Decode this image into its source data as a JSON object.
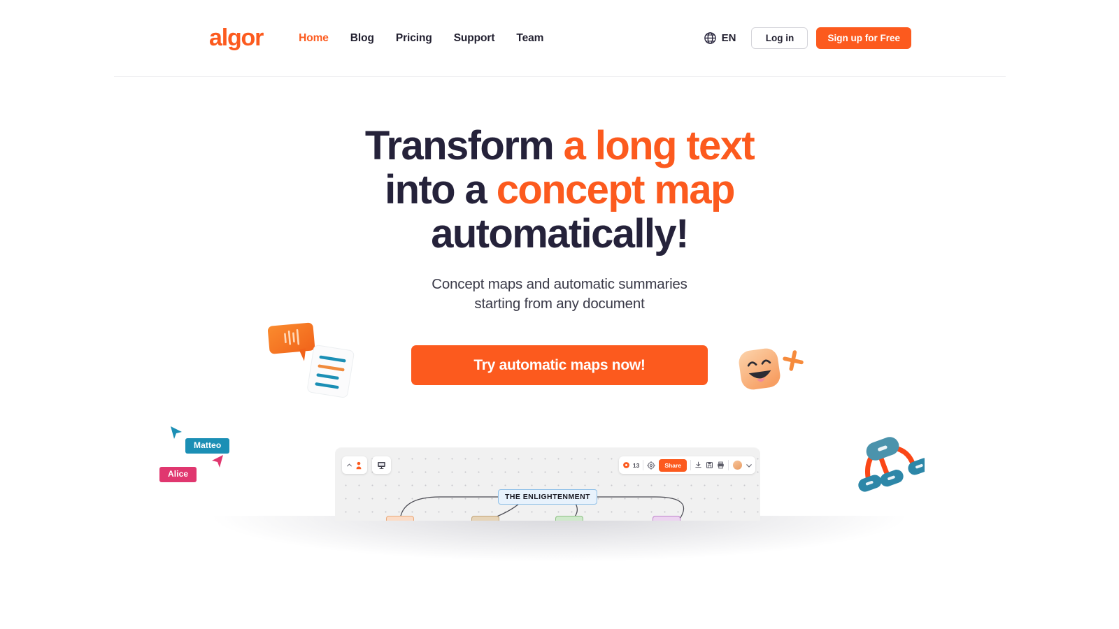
{
  "brand": {
    "logo_text": "algor",
    "accent_color": "#fc5a1e",
    "dark_color": "#25223a"
  },
  "header": {
    "nav": [
      {
        "label": "Home",
        "active": true
      },
      {
        "label": "Blog",
        "active": false
      },
      {
        "label": "Pricing",
        "active": false
      },
      {
        "label": "Support",
        "active": false
      },
      {
        "label": "Team",
        "active": false
      }
    ],
    "language": {
      "icon": "globe-icon",
      "code": "EN"
    },
    "login_label": "Log in",
    "signup_label": "Sign up for Free"
  },
  "hero": {
    "headline": {
      "line1_plain": "Transform ",
      "line1_accent": "a long text",
      "line2_plain": "into a ",
      "line2_accent": "concept map",
      "line3_plain": "automatically!"
    },
    "subtitle_line1": "Concept maps and automatic summaries",
    "subtitle_line2": "starting from any document",
    "cta_label": "Try automatic maps now!"
  },
  "decorations": {
    "speech_bubble": {
      "name": "speech-bubble-illustration",
      "color": "#f57c20"
    },
    "document_card": {
      "name": "document-illustration",
      "line_colors": [
        "#1b8fb5",
        "#f08a3c",
        "#1b8fb5",
        "#1b8fb5"
      ]
    },
    "smiley": {
      "name": "smiley-face-illustration",
      "color": "#f9b888"
    },
    "sparkle": {
      "name": "sparkle-icon",
      "color": "#f68b3c"
    },
    "node_graph": {
      "name": "node-graph-illustration",
      "node_color": "#3d8fab",
      "link_color": "#fa4616"
    }
  },
  "cursors": [
    {
      "name": "Matteo",
      "color": "#1b8fb5"
    },
    {
      "name": "Alice",
      "color": "#e0376f"
    }
  ],
  "app_mockup": {
    "toolbar_left": [
      {
        "icon": "chevron-up-icon",
        "secondary_icon": "pointer-cursor-icon"
      },
      {
        "icon": "presentation-icon"
      }
    ],
    "toolbar_right": {
      "comment_icon": "comment-dot-icon",
      "comment_count": "13",
      "settings_icon": "gear-icon",
      "share_label": "Share",
      "icons": [
        "download-icon",
        "save-icon",
        "print-icon"
      ],
      "avatar": "user-avatar",
      "chevron": "chevron-down-icon"
    },
    "map": {
      "root_node": "THE ENLIGHTENMENT",
      "child_nodes": [
        {
          "color": "#fbdcc7",
          "border": "#e9a878"
        },
        {
          "color": "#e6d4b8",
          "border": "#c2a477"
        },
        {
          "color": "#cfe9cb",
          "border": "#8cc184"
        },
        {
          "color": "#ecd4f0",
          "border": "#c084cc"
        }
      ]
    }
  }
}
